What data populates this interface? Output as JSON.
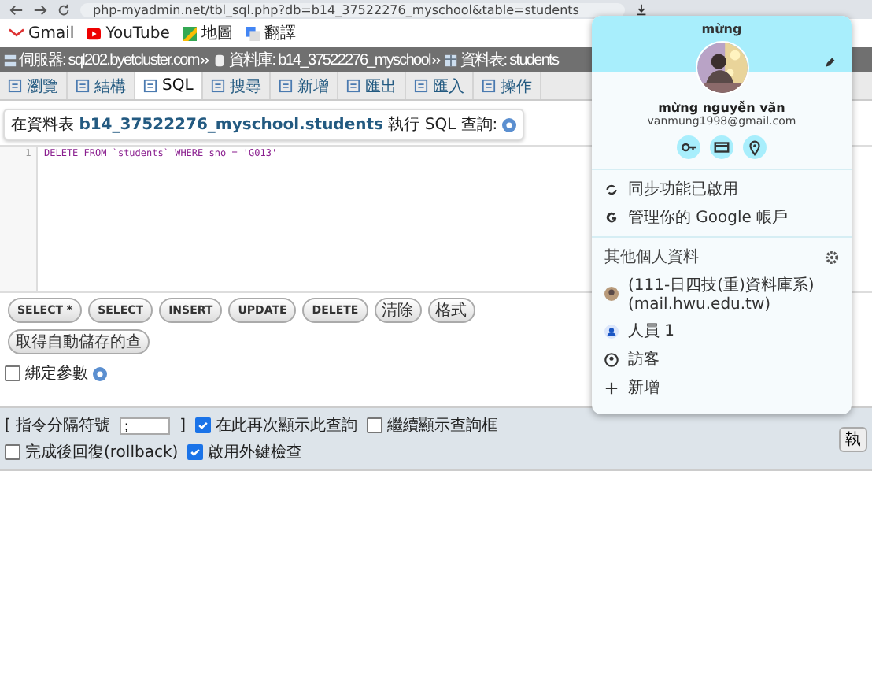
{
  "browser": {
    "url": "php-myadmin.net/tbl_sql.php?db=b14_37522276_myschool&table=students"
  },
  "bookmarks": [
    {
      "label": "Gmail",
      "kind": "gmail"
    },
    {
      "label": "YouTube",
      "kind": "youtube"
    },
    {
      "label": "地圖",
      "kind": "maps"
    },
    {
      "label": "翻譯",
      "kind": "translate"
    }
  ],
  "breadcrumb": [
    {
      "label": "伺服器: sql202.byetcluster.com",
      "kind": "server"
    },
    {
      "label": "資料庫: b14_37522276_myschool",
      "kind": "database"
    },
    {
      "label": "資料表: students",
      "kind": "table"
    }
  ],
  "tabs": [
    {
      "label": "瀏覽",
      "selected": false
    },
    {
      "label": "結構",
      "selected": false
    },
    {
      "label": "SQL",
      "selected": true
    },
    {
      "label": "搜尋",
      "selected": false
    },
    {
      "label": "新增",
      "selected": false
    },
    {
      "label": "匯出",
      "selected": false
    },
    {
      "label": "匯入",
      "selected": false
    },
    {
      "label": "操作",
      "selected": false
    }
  ],
  "query_title": "在資料表 **b14_37522276_myschool.students** 執行 SQL 查詢:",
  "editor": {
    "lines": [
      {
        "number": "1",
        "code": "DELETE FROM `students` WHERE sno = 'G013'"
      }
    ]
  },
  "query_buttons": [
    "SELECT *",
    "SELECT",
    "INSERT",
    "UPDATE",
    "DELETE",
    "清除",
    "格式",
    "取得自動儲存的查"
  ],
  "bind_params": {
    "label": "綁定參數",
    "checked": false
  },
  "options": {
    "delimiter_label": "[ 指令分隔符號",
    "delimiter_value": ";",
    "delimiter_end": "]",
    "checkboxes": [
      {
        "label": "在此再次顯示此查詢",
        "checked": true
      },
      {
        "label": "繼續顯示查詢框",
        "checked": false
      },
      {
        "label": "完成後回復(rollback)",
        "checked": false
      },
      {
        "label": "啟用外鍵檢查",
        "checked": true
      }
    ],
    "go_button": "執"
  },
  "profile_menu": {
    "short_name": "mừng",
    "full_name": "mừng nguyễn văn",
    "email": "vanmung1998@gmail.com",
    "actions": [
      {
        "label": "同步功能已啟用",
        "kind": "sync"
      },
      {
        "label": "管理你的 Google 帳戶",
        "kind": "google"
      }
    ],
    "other_title": "其他個人資料",
    "profiles": [
      {
        "label": "(111-日四技(重)資料庫系) (mail.hwu.edu.tw)",
        "kind": "avatar"
      },
      {
        "label": "人員 1",
        "kind": "person"
      },
      {
        "label": "訪客",
        "kind": "guest"
      },
      {
        "label": "新增",
        "kind": "add"
      }
    ]
  }
}
